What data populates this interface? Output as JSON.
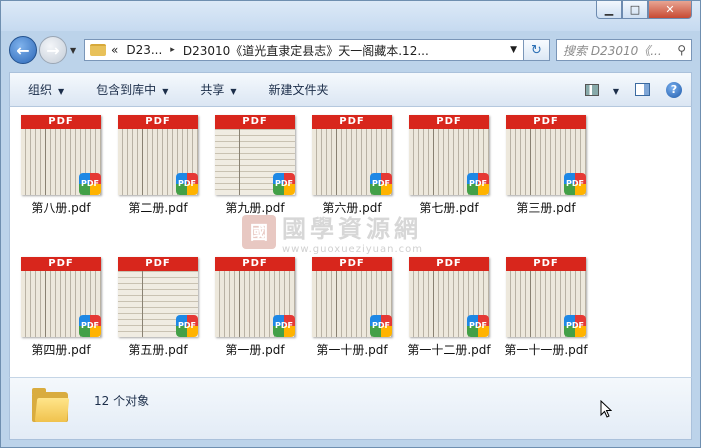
{
  "window": {
    "buttons": {
      "minimize": "▁",
      "maximize": "□",
      "close": "✕"
    }
  },
  "nav": {
    "back_icon": "arrow-left-icon",
    "forward_icon": "arrow-right-icon"
  },
  "address": {
    "overflow": "«",
    "crumbs": [
      "D23...",
      "D23010《道光直隶定县志》天一阁藏本.12..."
    ],
    "separator": "▸"
  },
  "search": {
    "placeholder": "搜索 D23010《..."
  },
  "toolbar": {
    "organize": "组织",
    "include": "包含到库中",
    "share": "共享",
    "new_folder": "新建文件夹"
  },
  "files": [
    {
      "name": "第八册.pdf",
      "band": "PDF",
      "badge": "PDF"
    },
    {
      "name": "第二册.pdf",
      "band": "PDF",
      "badge": "PDF"
    },
    {
      "name": "第九册.pdf",
      "band": "PDF",
      "badge": "PDF"
    },
    {
      "name": "第六册.pdf",
      "band": "PDF",
      "badge": "PDF"
    },
    {
      "name": "第七册.pdf",
      "band": "PDF",
      "badge": "PDF"
    },
    {
      "name": "第三册.pdf",
      "band": "PDF",
      "badge": "PDF"
    },
    {
      "name": "第四册.pdf",
      "band": "PDF",
      "badge": "PDF"
    },
    {
      "name": "第五册.pdf",
      "band": "PDF",
      "badge": "PDF"
    },
    {
      "name": "第一册.pdf",
      "band": "PDF",
      "badge": "PDF"
    },
    {
      "name": "第一十册.pdf",
      "band": "PDF",
      "badge": "PDF"
    },
    {
      "name": "第一十二册.pdf",
      "band": "PDF",
      "badge": "PDF"
    },
    {
      "name": "第一十一册.pdf",
      "band": "PDF",
      "badge": "PDF"
    }
  ],
  "watermark": {
    "seal": "國",
    "text": "國學資源網",
    "url": "www.guoxueziyuan.com"
  },
  "details": {
    "count": "12 个对象"
  },
  "colors": {
    "pdf_red": "#d8261c",
    "chrome": "#bcd3ea"
  }
}
